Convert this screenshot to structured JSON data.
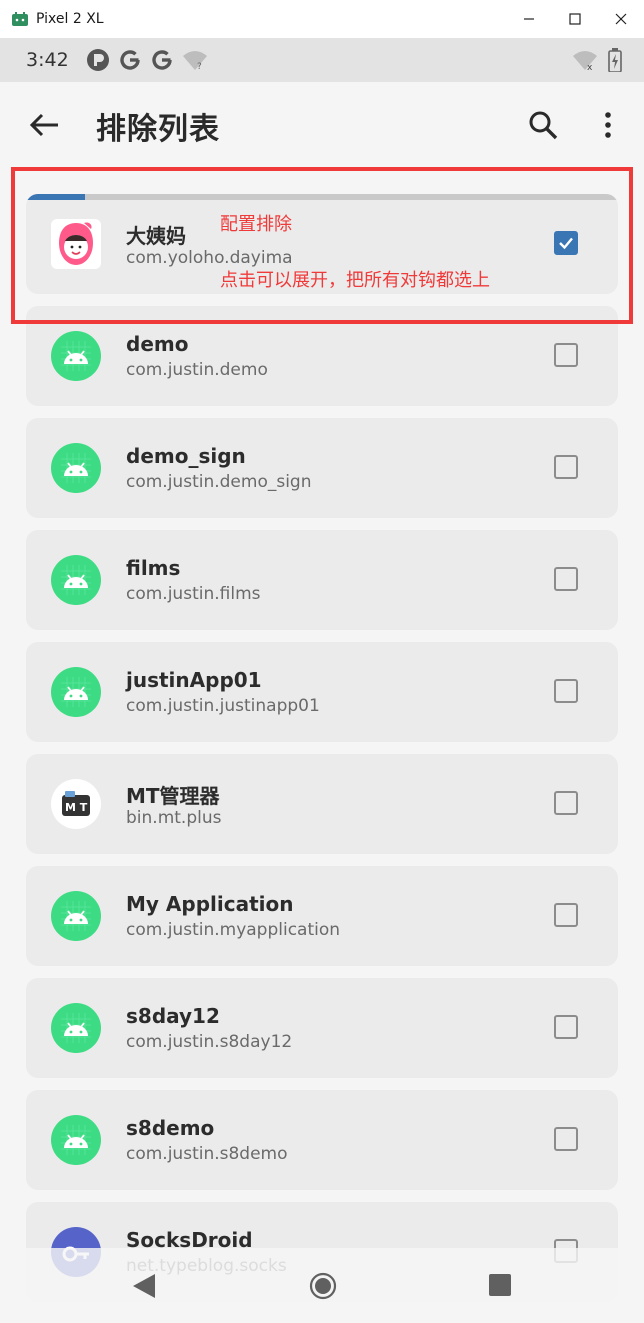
{
  "window": {
    "title": "Pixel 2 XL",
    "controls": [
      "minimize",
      "maximize",
      "close"
    ]
  },
  "statusbar": {
    "time": "3:42",
    "left_icons": [
      "app-p-icon",
      "google-g-icon",
      "google-g-icon",
      "wifi-unknown-icon"
    ],
    "right_icons": [
      "wifi-off-icon",
      "battery-charging-icon"
    ]
  },
  "appbar": {
    "title": "排除列表",
    "back_icon": "arrow-left-icon",
    "search_icon": "search-icon",
    "more_icon": "more-vert-icon"
  },
  "colors": {
    "accent": "#3a76b3",
    "android_green": "#3ddc84",
    "annotation_red": "#f03a3a"
  },
  "items": [
    {
      "name": "大姨妈",
      "package": "com.yoloho.dayima",
      "checked": true,
      "icon": "dayima-app-icon",
      "progress": 0.1
    },
    {
      "name": "demo",
      "package": "com.justin.demo",
      "checked": false,
      "icon": "android-icon"
    },
    {
      "name": "demo_sign",
      "package": "com.justin.demo_sign",
      "checked": false,
      "icon": "android-icon"
    },
    {
      "name": "films",
      "package": "com.justin.films",
      "checked": false,
      "icon": "android-icon"
    },
    {
      "name": "justinApp01",
      "package": "com.justin.justinapp01",
      "checked": false,
      "icon": "android-icon"
    },
    {
      "name": "MT管理器",
      "package": "bin.mt.plus",
      "checked": false,
      "icon": "mt-manager-icon"
    },
    {
      "name": "My Application",
      "package": "com.justin.myapplication",
      "checked": false,
      "icon": "android-icon"
    },
    {
      "name": "s8day12",
      "package": "com.justin.s8day12",
      "checked": false,
      "icon": "android-icon"
    },
    {
      "name": "s8demo",
      "package": "com.justin.s8demo",
      "checked": false,
      "icon": "android-icon"
    },
    {
      "name": "SocksDroid",
      "package": "net.typeblog.socks",
      "checked": false,
      "icon": "socksdroid-icon"
    }
  ],
  "annotation": {
    "label1": "配置排除",
    "label2": "点击可以展开，把所有对钩都选上"
  },
  "navbar": {
    "icons": [
      "nav-back-icon",
      "nav-home-icon",
      "nav-recents-icon"
    ]
  }
}
